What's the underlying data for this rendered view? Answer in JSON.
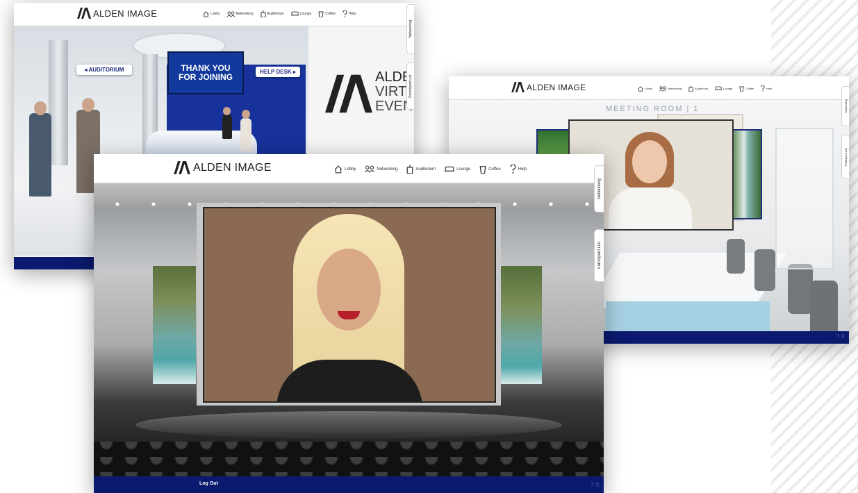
{
  "brand": {
    "name": "ALDEN",
    "suffix": "IMAGE"
  },
  "nav": [
    {
      "label": "Lobby",
      "icon": "house-icon"
    },
    {
      "label": "Networking",
      "icon": "people-icon"
    },
    {
      "label": "Auditorium",
      "icon": "podium-icon"
    },
    {
      "label": "Lounge",
      "icon": "couch-icon"
    },
    {
      "label": "Coffee",
      "icon": "coffee-cup-icon"
    },
    {
      "label": "Help",
      "icon": "help-icon"
    }
  ],
  "side_tabs": {
    "networking": "Networking",
    "participants": "Participant List"
  },
  "lobby": {
    "sign_auditorium": "◂ AUDITORIUM",
    "sign_helpdesk": "HELP DESK ▸",
    "screen_line1": "THANK YOU",
    "screen_line2": "FOR JOINING",
    "wall_brand": "ALDE",
    "wall_line2": "VIRTU",
    "wall_line3": "EVENT"
  },
  "meeting": {
    "room_label": "MEETING ROOM | 1"
  },
  "auditorium": {
    "logout": "Log Out",
    "corner_controls": "? X"
  },
  "colors": {
    "footer": "#0b1a6e",
    "accent": "#1c2a80",
    "screen_blue": "#123a9c"
  }
}
